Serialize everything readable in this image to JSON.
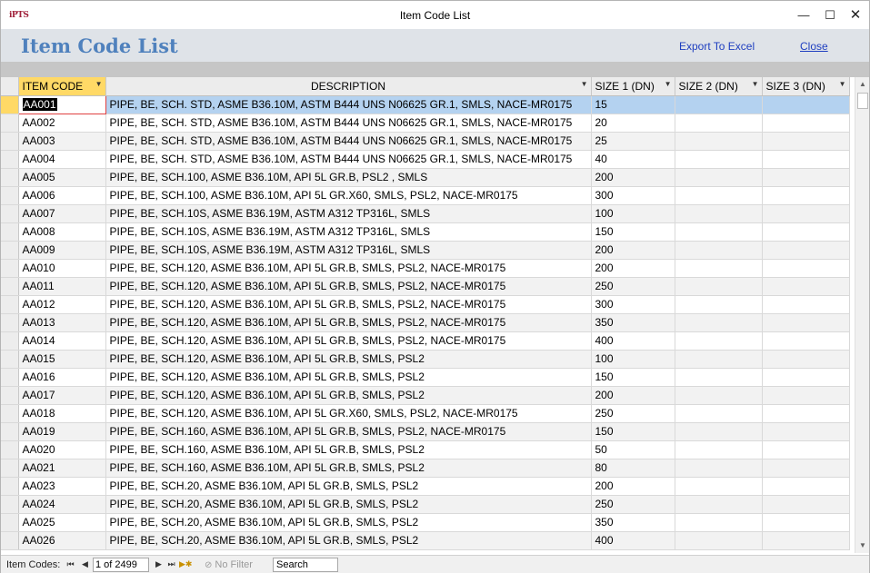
{
  "window": {
    "title": "Item Code List",
    "app_icon_text": "iPTS",
    "minimize_glyph": "—",
    "maximize_glyph": "☐",
    "close_glyph": "✕"
  },
  "header": {
    "form_title": "Item Code List",
    "export_label": "Export To Excel",
    "close_label": "Close"
  },
  "columns": {
    "item_code": "ITEM CODE",
    "description": "DESCRIPTION",
    "size1": "SIZE 1 (DN)",
    "size2": "SIZE 2 (DN)",
    "size3": "SIZE 3 (DN)"
  },
  "rows": [
    {
      "code": "AA001",
      "desc": "PIPE, BE, SCH. STD, ASME B36.10M, ASTM B444 UNS N06625 GR.1, SMLS, NACE-MR0175",
      "s1": "15",
      "s2": "",
      "s3": ""
    },
    {
      "code": "AA002",
      "desc": "PIPE, BE, SCH. STD, ASME B36.10M, ASTM B444 UNS N06625 GR.1, SMLS, NACE-MR0175",
      "s1": "20",
      "s2": "",
      "s3": ""
    },
    {
      "code": "AA003",
      "desc": "PIPE, BE, SCH. STD, ASME B36.10M, ASTM B444 UNS N06625 GR.1, SMLS, NACE-MR0175",
      "s1": "25",
      "s2": "",
      "s3": ""
    },
    {
      "code": "AA004",
      "desc": "PIPE, BE, SCH. STD, ASME B36.10M, ASTM B444 UNS N06625 GR.1, SMLS, NACE-MR0175",
      "s1": "40",
      "s2": "",
      "s3": ""
    },
    {
      "code": "AA005",
      "desc": "PIPE, BE, SCH.100, ASME B36.10M, API 5L GR.B, PSL2 , SMLS",
      "s1": "200",
      "s2": "",
      "s3": ""
    },
    {
      "code": "AA006",
      "desc": "PIPE, BE, SCH.100, ASME B36.10M, API 5L GR.X60, SMLS, PSL2, NACE-MR0175",
      "s1": "300",
      "s2": "",
      "s3": ""
    },
    {
      "code": "AA007",
      "desc": "PIPE, BE, SCH.10S, ASME B36.19M, ASTM A312 TP316L, SMLS",
      "s1": "100",
      "s2": "",
      "s3": ""
    },
    {
      "code": "AA008",
      "desc": "PIPE, BE, SCH.10S, ASME B36.19M, ASTM A312 TP316L, SMLS",
      "s1": "150",
      "s2": "",
      "s3": ""
    },
    {
      "code": "AA009",
      "desc": "PIPE, BE, SCH.10S, ASME B36.19M, ASTM A312 TP316L, SMLS",
      "s1": "200",
      "s2": "",
      "s3": ""
    },
    {
      "code": "AA010",
      "desc": "PIPE, BE, SCH.120, ASME B36.10M, API 5L GR.B, SMLS, PSL2, NACE-MR0175",
      "s1": "200",
      "s2": "",
      "s3": ""
    },
    {
      "code": "AA011",
      "desc": "PIPE, BE, SCH.120, ASME B36.10M, API 5L GR.B, SMLS, PSL2, NACE-MR0175",
      "s1": "250",
      "s2": "",
      "s3": ""
    },
    {
      "code": "AA012",
      "desc": "PIPE, BE, SCH.120, ASME B36.10M, API 5L GR.B, SMLS, PSL2, NACE-MR0175",
      "s1": "300",
      "s2": "",
      "s3": ""
    },
    {
      "code": "AA013",
      "desc": "PIPE, BE, SCH.120, ASME B36.10M, API 5L GR.B, SMLS, PSL2, NACE-MR0175",
      "s1": "350",
      "s2": "",
      "s3": ""
    },
    {
      "code": "AA014",
      "desc": "PIPE, BE, SCH.120, ASME B36.10M, API 5L GR.B, SMLS, PSL2, NACE-MR0175",
      "s1": "400",
      "s2": "",
      "s3": ""
    },
    {
      "code": "AA015",
      "desc": "PIPE, BE, SCH.120, ASME B36.10M, API 5L GR.B, SMLS, PSL2",
      "s1": "100",
      "s2": "",
      "s3": ""
    },
    {
      "code": "AA016",
      "desc": "PIPE, BE, SCH.120, ASME B36.10M, API 5L GR.B, SMLS, PSL2",
      "s1": "150",
      "s2": "",
      "s3": ""
    },
    {
      "code": "AA017",
      "desc": "PIPE, BE, SCH.120, ASME B36.10M, API 5L GR.B, SMLS, PSL2",
      "s1": "200",
      "s2": "",
      "s3": ""
    },
    {
      "code": "AA018",
      "desc": "PIPE, BE, SCH.120, ASME B36.10M, API 5L GR.X60, SMLS, PSL2, NACE-MR0175",
      "s1": "250",
      "s2": "",
      "s3": ""
    },
    {
      "code": "AA019",
      "desc": "PIPE, BE, SCH.160, ASME B36.10M, API 5L GR.B, SMLS, PSL2, NACE-MR0175",
      "s1": "150",
      "s2": "",
      "s3": ""
    },
    {
      "code": "AA020",
      "desc": "PIPE, BE, SCH.160, ASME B36.10M, API 5L GR.B, SMLS, PSL2",
      "s1": "50",
      "s2": "",
      "s3": ""
    },
    {
      "code": "AA021",
      "desc": "PIPE, BE, SCH.160, ASME B36.10M, API 5L GR.B, SMLS, PSL2",
      "s1": "80",
      "s2": "",
      "s3": ""
    },
    {
      "code": "AA023",
      "desc": "PIPE, BE, SCH.20, ASME B36.10M, API 5L GR.B, SMLS, PSL2",
      "s1": "200",
      "s2": "",
      "s3": ""
    },
    {
      "code": "AA024",
      "desc": "PIPE, BE, SCH.20, ASME B36.10M, API 5L GR.B, SMLS, PSL2",
      "s1": "250",
      "s2": "",
      "s3": ""
    },
    {
      "code": "AA025",
      "desc": "PIPE, BE, SCH.20, ASME B36.10M, API 5L GR.B, SMLS, PSL2",
      "s1": "350",
      "s2": "",
      "s3": ""
    },
    {
      "code": "AA026",
      "desc": "PIPE, BE, SCH.20, ASME B36.10M, API 5L GR.B, SMLS, PSL2",
      "s1": "400",
      "s2": "",
      "s3": ""
    }
  ],
  "navigation": {
    "label": "Item Codes:",
    "record_text": "1 of 2499",
    "filter_label": "No Filter",
    "search_label": "Search",
    "first_glyph": "⏮",
    "prev_glyph": "◀",
    "next_glyph": "▶",
    "last_glyph": "⏭",
    "new_glyph": "▶✱"
  },
  "colors": {
    "accent_title": "#4f81bd",
    "selected_row": "#b4d2f0",
    "active_header": "#ffd966",
    "link": "#1f3fc0"
  }
}
